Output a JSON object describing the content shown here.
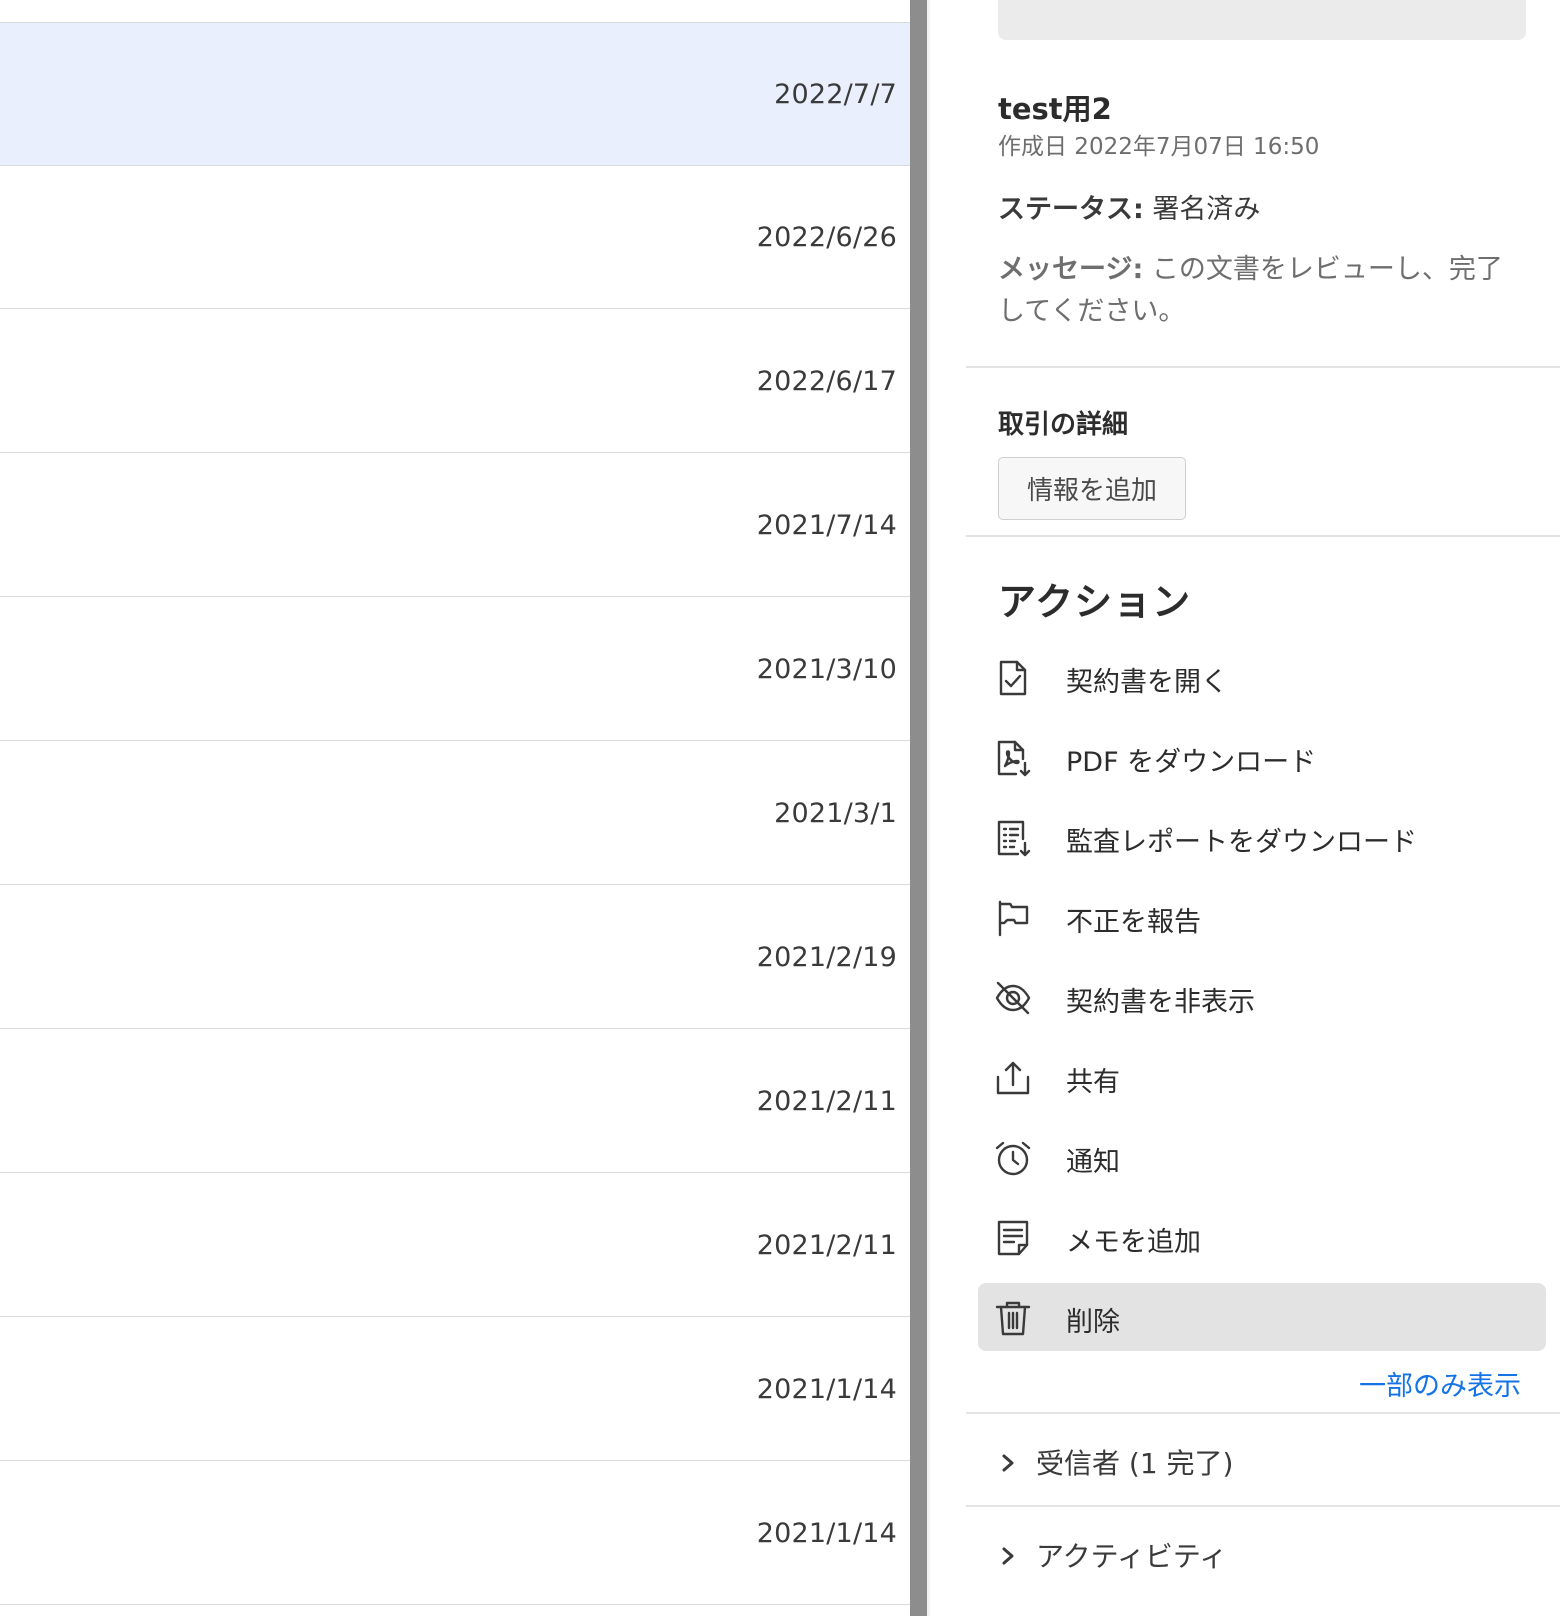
{
  "list": {
    "rows": [
      {
        "date": "2022/7/7",
        "selected": true
      },
      {
        "date": "2022/6/26",
        "selected": false
      },
      {
        "date": "2022/6/17",
        "selected": false
      },
      {
        "date": "2021/7/14",
        "selected": false
      },
      {
        "date": "2021/3/10",
        "selected": false
      },
      {
        "date": "2021/3/1",
        "selected": false
      },
      {
        "date": "2021/2/19",
        "selected": false
      },
      {
        "date": "2021/2/11",
        "selected": false
      },
      {
        "date": "2021/2/11",
        "selected": false
      },
      {
        "date": "2021/1/14",
        "selected": false
      },
      {
        "date": "2021/1/14",
        "selected": false
      }
    ]
  },
  "panel": {
    "title": "test用2",
    "created": "作成日 2022年7月07日 16:50",
    "status_label": "ステータス:",
    "status_value": "署名済み",
    "message_label": "メッセージ:",
    "message_value": "この文書をレビューし、完了してください。",
    "transaction_heading": "取引の詳細",
    "add_info_button": "情報を追加",
    "actions_heading": "アクション",
    "actions": [
      {
        "label": "契約書を開く",
        "icon": "document-check-icon"
      },
      {
        "label": "PDF をダウンロード",
        "icon": "pdf-download-icon"
      },
      {
        "label": "監査レポートをダウンロード",
        "icon": "report-download-icon"
      },
      {
        "label": "不正を報告",
        "icon": "flag-icon"
      },
      {
        "label": "契約書を非表示",
        "icon": "eye-off-icon"
      },
      {
        "label": "共有",
        "icon": "share-icon"
      },
      {
        "label": "通知",
        "icon": "alarm-clock-icon"
      },
      {
        "label": "メモを追加",
        "icon": "note-icon"
      },
      {
        "label": "削除",
        "icon": "trash-icon",
        "highlighted": true
      }
    ],
    "show_less_link": "一部のみ表示",
    "recipients_label": "受信者 (1 完了)",
    "activity_label": "アクティビティ"
  },
  "colors": {
    "selected_row": "#e9effc",
    "link": "#1473e6",
    "highlight": "#e3e3e3",
    "scrollbar_thumb": "#8d8d8d"
  }
}
